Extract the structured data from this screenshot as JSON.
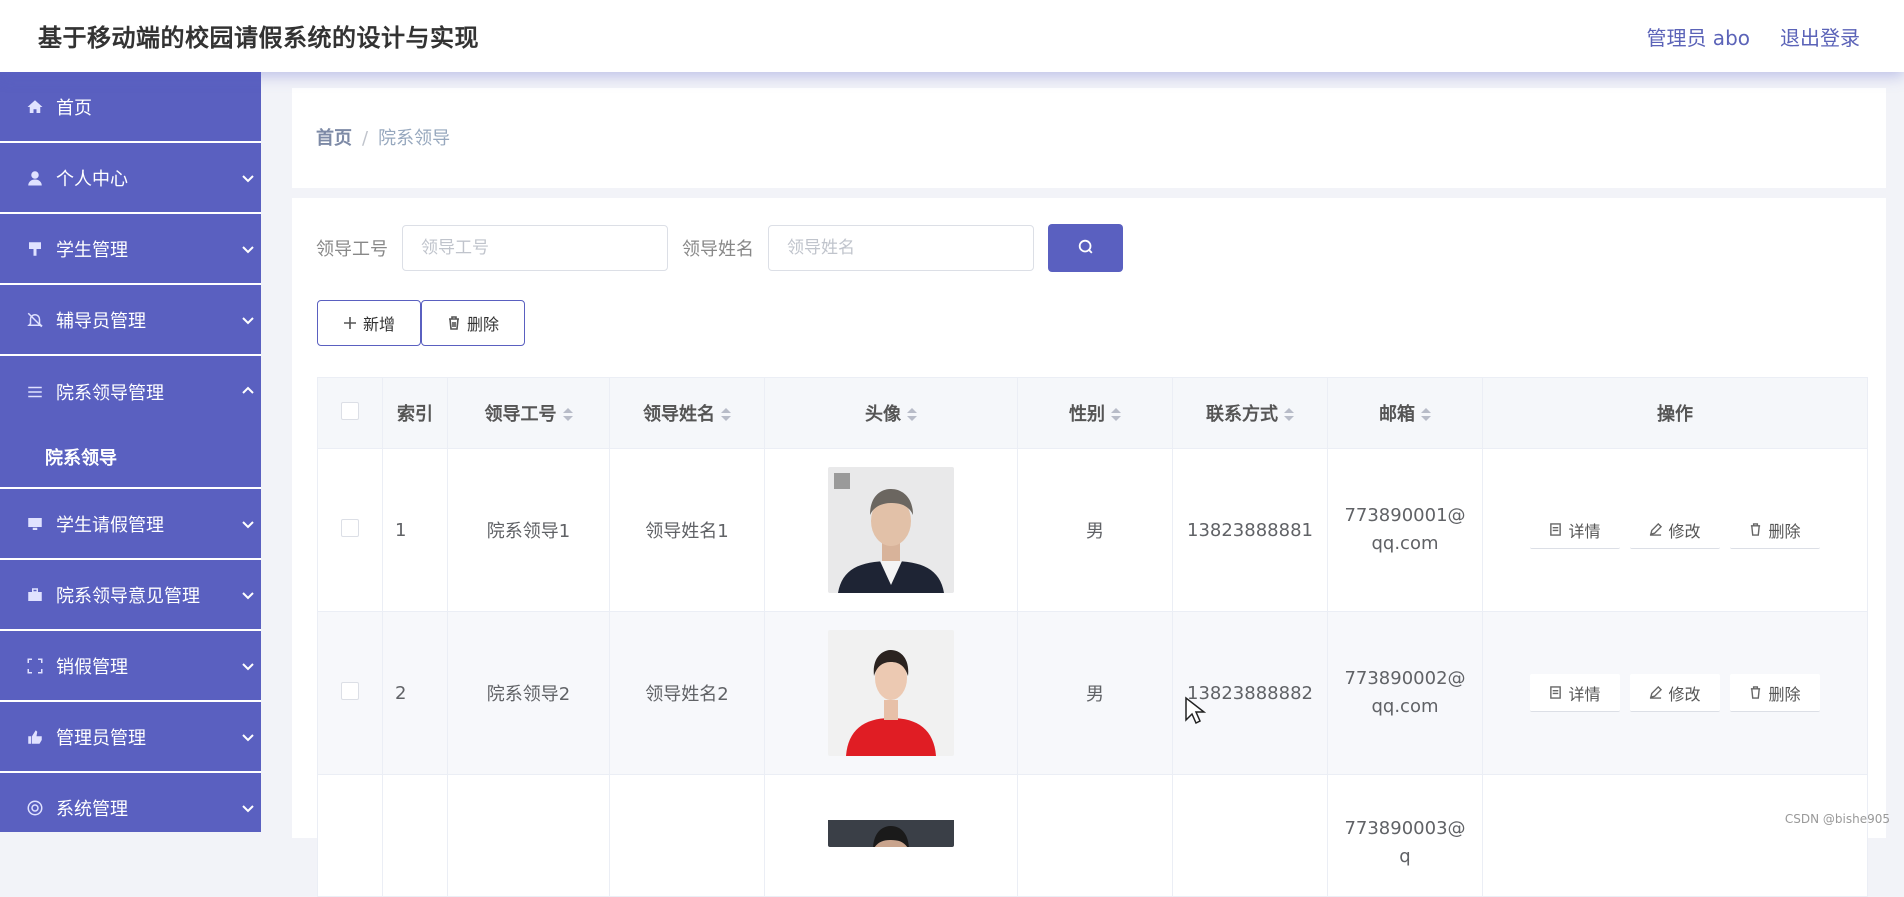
{
  "header": {
    "title": "基于移动端的校园请假系统的设计与实现",
    "user_label": "管理员 abo",
    "logout_label": "退出登录"
  },
  "sidebar": {
    "items": [
      {
        "label": "首页",
        "icon": "home-icon"
      },
      {
        "label": "个人中心",
        "icon": "user-icon"
      },
      {
        "label": "学生管理",
        "icon": "flag-icon"
      },
      {
        "label": "辅导员管理",
        "icon": "bell-off-icon"
      },
      {
        "label": "院系领导管理",
        "icon": "menu-icon",
        "expanded": true,
        "children": [
          {
            "label": "院系领导"
          }
        ]
      },
      {
        "label": "学生请假管理",
        "icon": "monitor-icon"
      },
      {
        "label": "院系领导意见管理",
        "icon": "briefcase-icon"
      },
      {
        "label": "销假管理",
        "icon": "fullscreen-icon"
      },
      {
        "label": "管理员管理",
        "icon": "thumb-icon"
      },
      {
        "label": "系统管理",
        "icon": "globe-icon"
      }
    ]
  },
  "breadcrumb": {
    "home": "首页",
    "sep": "/",
    "current": "院系领导"
  },
  "search": {
    "field1_label": "领导工号",
    "field1_placeholder": "领导工号",
    "field2_label": "领导姓名",
    "field2_placeholder": "领导姓名"
  },
  "actions": {
    "add_label": "新增",
    "delete_label": "删除"
  },
  "table": {
    "headers": [
      "索引",
      "领导工号",
      "领导姓名",
      "头像",
      "性别",
      "联系方式",
      "邮箱",
      "操作"
    ],
    "rows": [
      {
        "index": "1",
        "id": "院系领导1",
        "name": "领导姓名1",
        "gender": "男",
        "phone": "13823888881",
        "email": "773890001@qq.com"
      },
      {
        "index": "2",
        "id": "院系领导2",
        "name": "领导姓名2",
        "gender": "男",
        "phone": "13823888882",
        "email": "773890002@qq.com"
      },
      {
        "index": "",
        "id": "",
        "name": "",
        "gender": "",
        "phone": "",
        "email": "773890003@q"
      }
    ],
    "op_labels": {
      "detail": "详情",
      "edit": "修改",
      "delete": "删除"
    }
  },
  "watermark": "CSDN @bishe905",
  "colors": {
    "accent": "#5a60c0",
    "header_text": "#5b63b8"
  }
}
